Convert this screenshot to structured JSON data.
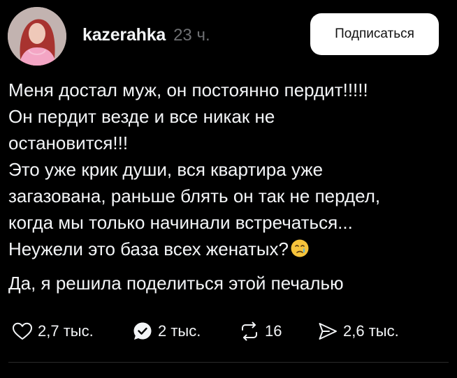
{
  "post": {
    "username": "kazerahka",
    "time": "23 ч.",
    "follow_label": "Подписаться",
    "text_p1": "Меня достал муж, он постоянно пердит!!!!!\nОн пердит везде и все никак не\nостановится!!!\nЭто уже крик души, вся квартира уже\nзагазована, раньше блять он так не пердел,\nкогда мы только начинали встречаться...\nНеужели это база всех женатых?",
    "text_p2": "Да, я решила поделиться этой печалью"
  },
  "actions": {
    "likes": "2,7 тыс.",
    "replies": "2 тыс.",
    "reposts": "16",
    "shares": "2,6 тыс."
  },
  "icons": {
    "like": "heart-icon",
    "reply": "speech-bubble-check-icon",
    "repost": "repost-icon",
    "share": "send-icon",
    "emoji": "crying-face-icon"
  },
  "colors": {
    "background": "#000000",
    "text": "#f3f5f7",
    "muted": "#6e6f72",
    "button_bg": "#ffffff"
  }
}
